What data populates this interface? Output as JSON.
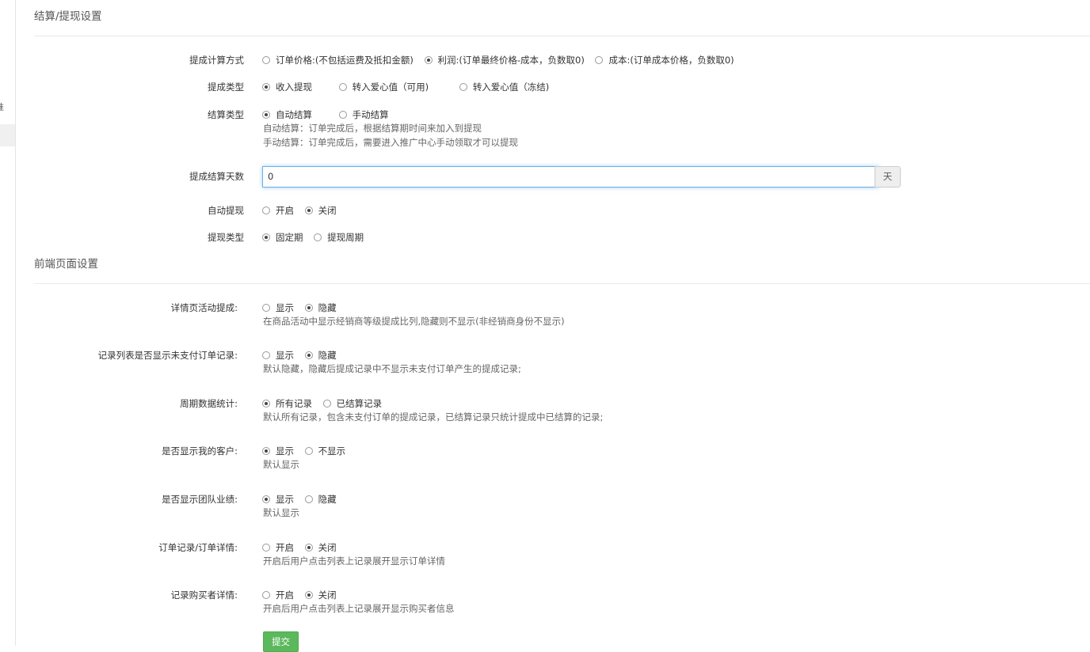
{
  "sidebar": {
    "partial_char": "准"
  },
  "section1": {
    "title": "结算/提现设置"
  },
  "section2": {
    "title": "前端页面设置"
  },
  "commission_calc": {
    "label": "提成计算方式",
    "opt1": "订单价格:(不包括运费及抵扣金额)",
    "opt2": "利润:(订单最终价格-成本，负数取0)",
    "opt3": "成本:(订单成本价格，负数取0)",
    "selected": "opt2"
  },
  "commission_type": {
    "label": "提成类型",
    "opt1": "收入提现",
    "opt2": "转入爱心值（可用)",
    "opt3": "转入爱心值（冻结)",
    "selected": "opt1"
  },
  "settle_type": {
    "label": "结算类型",
    "opt1": "自动结算",
    "opt2": "手动结算",
    "selected": "opt1",
    "help1": "自动结算：订单完成后，根据结算期时间来加入到提现",
    "help2": "手动结算：订单完成后，需要进入推广中心手动领取才可以提现"
  },
  "settle_days": {
    "label": "提成结算天数",
    "value": "0",
    "unit": "天"
  },
  "auto_withdraw": {
    "label": "自动提现",
    "opt1": "开启",
    "opt2": "关闭",
    "selected": "opt2"
  },
  "withdraw_type": {
    "label": "提现类型",
    "opt1": "固定期",
    "opt2": "提现周期",
    "selected": "opt1"
  },
  "detail_commission": {
    "label": "详情页活动提成:",
    "opt1": "显示",
    "opt2": "隐藏",
    "selected": "opt2",
    "help": "在商品活动中显示经销商等级提成比列,隐藏则不显示(非经销商身份不显示)"
  },
  "unpaid_records": {
    "label": "记录列表是否显示未支付订单记录:",
    "opt1": "显示",
    "opt2": "隐藏",
    "selected": "opt2",
    "help": "默认隐藏，隐藏后提成记录中不显示未支付订单产生的提成记录;"
  },
  "period_stats": {
    "label": "周期数据统计:",
    "opt1": "所有记录",
    "opt2": "已结算记录",
    "selected": "opt1",
    "help": "默认所有记录，包含未支付订单的提成记录，已结算记录只统计提成中已结算的记录;"
  },
  "show_customers": {
    "label": "是否显示我的客户:",
    "opt1": "显示",
    "opt2": "不显示",
    "selected": "opt1",
    "help": "默认显示"
  },
  "show_team": {
    "label": "是否显示团队业绩:",
    "opt1": "显示",
    "opt2": "隐藏",
    "selected": "opt1",
    "help": "默认显示"
  },
  "order_detail": {
    "label": "订单记录/订单详情:",
    "opt1": "开启",
    "opt2": "关闭",
    "selected": "opt2",
    "help": "开启后用户点击列表上记录展开显示订单详情"
  },
  "buyer_detail": {
    "label": "记录购买者详情:",
    "opt1": "开启",
    "opt2": "关闭",
    "selected": "opt2",
    "help": "开启后用户点击列表上记录展开显示购买者信息"
  },
  "submit": {
    "label": "提交"
  }
}
